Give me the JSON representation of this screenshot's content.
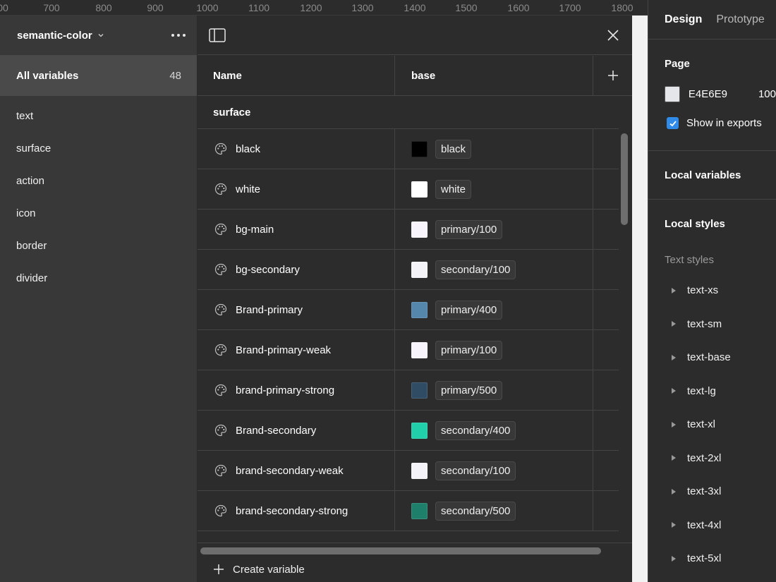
{
  "ruler": {
    "ticks": [
      "00",
      "700",
      "800",
      "900",
      "1000",
      "1100",
      "1200",
      "1300",
      "1400",
      "1500",
      "1600",
      "1700",
      "1800"
    ]
  },
  "collection": {
    "name": "semantic-color"
  },
  "sidebar": {
    "all_label": "All variables",
    "all_count": "48",
    "groups": [
      "text",
      "surface",
      "action",
      "icon",
      "border",
      "divider"
    ]
  },
  "table": {
    "col_name": "Name",
    "col_mode": "base",
    "group_label": "surface",
    "rows": [
      {
        "name": "black",
        "value": "black",
        "color": "#000000"
      },
      {
        "name": "white",
        "value": "white",
        "color": "#ffffff"
      },
      {
        "name": "bg-main",
        "value": "primary/100",
        "color": "#f7f5fb"
      },
      {
        "name": "bg-secondary",
        "value": "secondary/100",
        "color": "#f4f4f8"
      },
      {
        "name": "Brand-primary",
        "value": "primary/400",
        "color": "#5587ad"
      },
      {
        "name": "Brand-primary-weak",
        "value": "primary/100",
        "color": "#f7f5fb"
      },
      {
        "name": "brand-primary-strong",
        "value": "primary/500",
        "color": "#2f4c64"
      },
      {
        "name": "Brand-secondary",
        "value": "secondary/400",
        "color": "#21cfab"
      },
      {
        "name": "brand-secondary-weak",
        "value": "secondary/100",
        "color": "#f4f4f8"
      },
      {
        "name": "brand-secondary-strong",
        "value": "secondary/500",
        "color": "#1e7f6a"
      }
    ],
    "create_label": "Create variable"
  },
  "right_panel": {
    "tabs": [
      "Design",
      "Prototype"
    ],
    "page_title": "Page",
    "page_fill_hex": "E4E6E9",
    "page_fill_color": "#e4e6e9",
    "page_fill_opacity": "100",
    "show_exports": "Show in exports",
    "local_variables": "Local variables",
    "local_styles": "Local styles",
    "text_styles_title": "Text styles",
    "text_styles": [
      "text-xs",
      "text-sm",
      "text-base",
      "text-lg",
      "text-xl",
      "text-2xl",
      "text-3xl",
      "text-4xl",
      "text-5xl"
    ]
  },
  "colors": {
    "accent": "#2f8ae8",
    "bg": "#2c2c2c",
    "sidebar_bg": "#383838"
  }
}
